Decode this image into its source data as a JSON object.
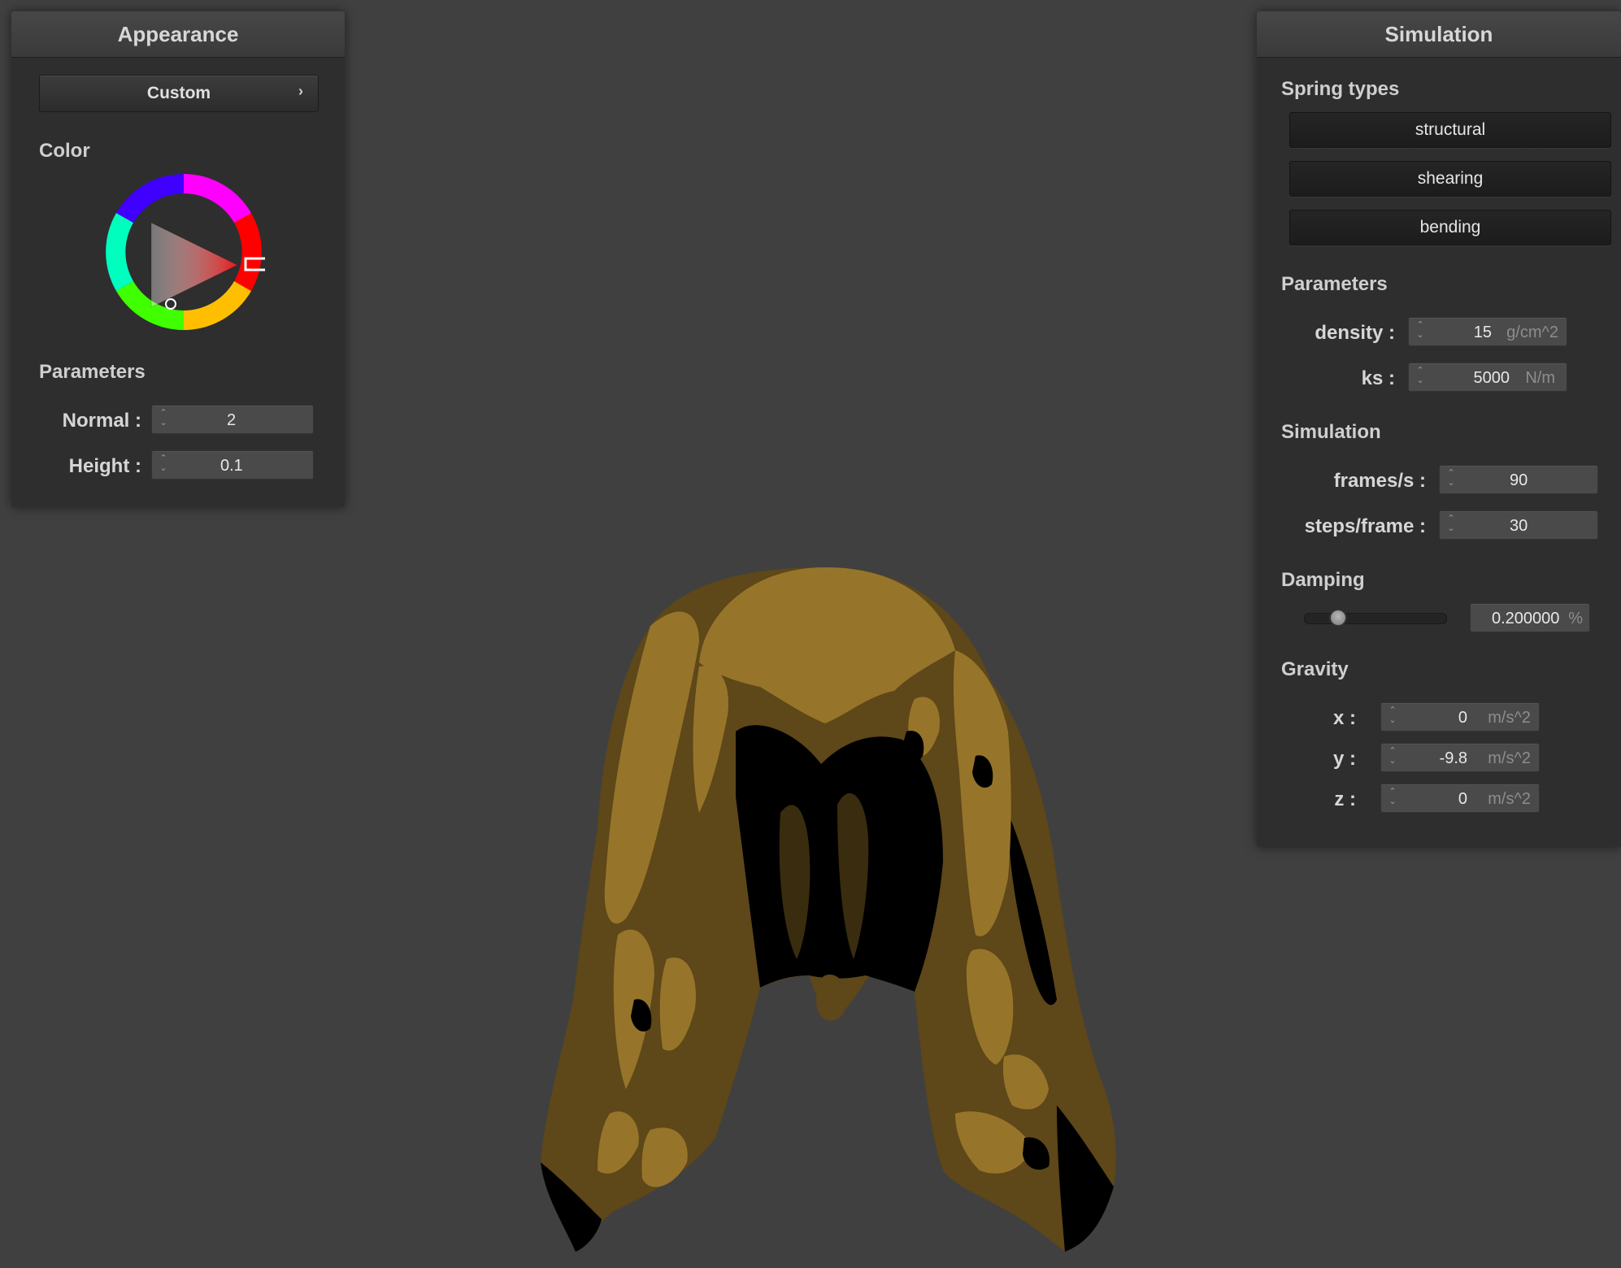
{
  "appearance": {
    "title": "Appearance",
    "preset_label": "Custom",
    "color_title": "Color",
    "params_title": "Parameters",
    "normal_label": "Normal :",
    "normal_value": "2",
    "height_label": "Height :",
    "height_value": "0.1",
    "selected_hue_color": "#e61a1a"
  },
  "simulation": {
    "title": "Simulation",
    "spring_types_title": "Spring types",
    "spring_buttons": [
      "structural",
      "shearing",
      "bending"
    ],
    "params_title": "Parameters",
    "density_label": "density :",
    "density_value": "15",
    "density_unit": "g/cm^2",
    "ks_label": "ks :",
    "ks_value": "5000",
    "ks_unit": "N/m",
    "sim_title": "Simulation",
    "fps_label": "frames/s :",
    "fps_value": "90",
    "steps_label": "steps/frame :",
    "steps_value": "30",
    "damping_title": "Damping",
    "damping_value": "0.200000",
    "damping_unit": "%",
    "damping_fraction": 0.2,
    "gravity_title": "Gravity",
    "gx_label": "x :",
    "gx_value": "0",
    "gy_label": "y :",
    "gy_value": "-9.8",
    "gz_label": "z :",
    "gz_value": "0",
    "gravity_unit": "m/s^2"
  },
  "viewport": {
    "cloth_colors": {
      "light": "#96752b",
      "mid": "#5e4718",
      "shadow": "#000000"
    }
  }
}
